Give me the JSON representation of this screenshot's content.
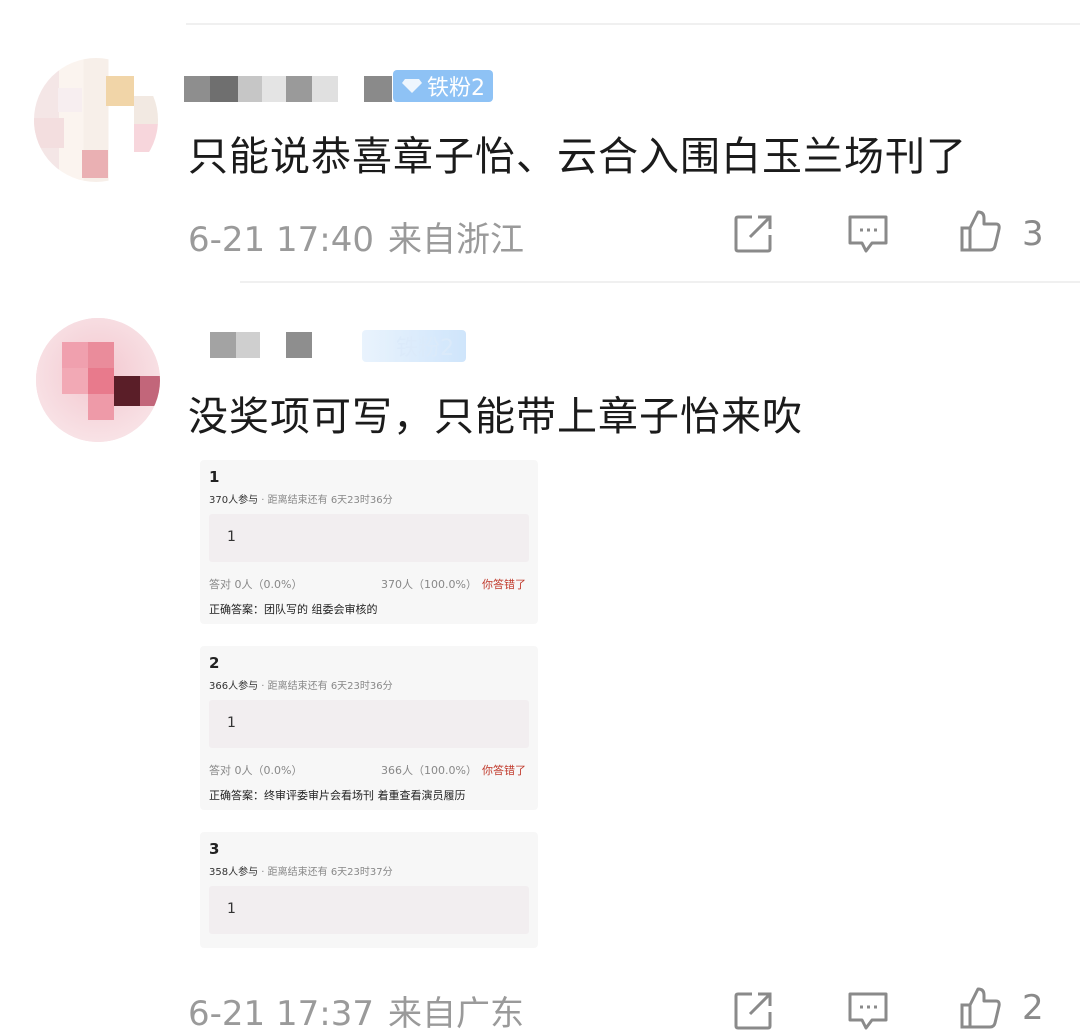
{
  "comments": [
    {
      "badge": "铁粉2",
      "text": "只能说恭喜章子怡、云合入围白玉兰场刊了",
      "time": "6-21 17:40",
      "location": "来自浙江",
      "likes": "3"
    },
    {
      "badge": "铁粉2",
      "text": "没奖项可写，只能带上章子怡来吹",
      "time": "6-21 17:37",
      "location": "来自广东",
      "likes": "2"
    }
  ],
  "quiz_cards": [
    {
      "number": "1",
      "participants": "370人参与",
      "deadline": "· 距离结束还有 6天23时36分",
      "answer": "1",
      "correct_stat": "答对  0人（0.0%）",
      "wrong_stat": "370人（100.0%）",
      "wrong_label": "你答错了",
      "correct_answer": "正确答案：团队写的 组委会审核的"
    },
    {
      "number": "2",
      "participants": "366人参与",
      "deadline": "· 距离结束还有 6天23时36分",
      "answer": "1",
      "correct_stat": "答对  0人（0.0%）",
      "wrong_stat": "366人（100.0%）",
      "wrong_label": "你答错了",
      "correct_answer": "正确答案：终审评委审片会看场刊 着重查看演员履历"
    },
    {
      "number": "3",
      "participants": "358人参与",
      "deadline": "· 距离结束还有 6天23时37分",
      "answer": "1"
    }
  ],
  "icons": {
    "share": "share-icon",
    "comment": "comment-icon",
    "like": "thumbs-up-icon",
    "badge": "diamond-icon"
  },
  "colors": {
    "badge": "#8ec2f5",
    "wrong": "#c0392b",
    "meta": "#9a9a9a"
  }
}
